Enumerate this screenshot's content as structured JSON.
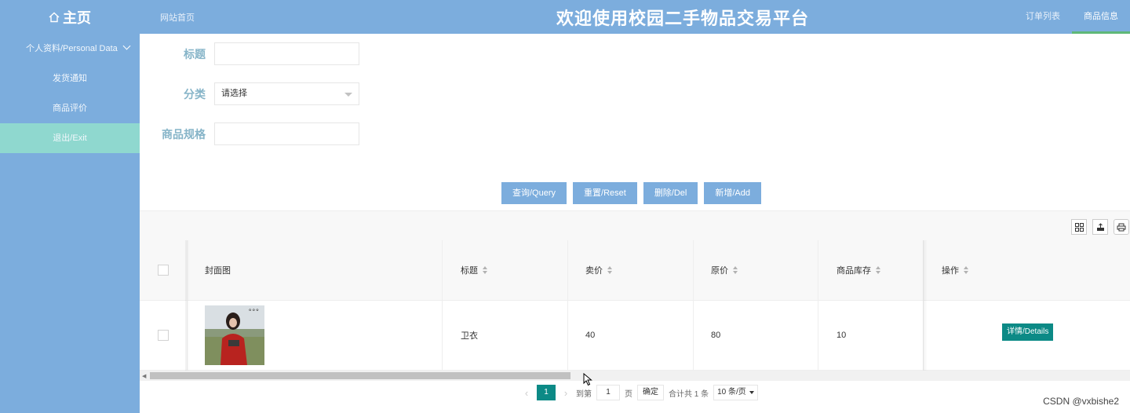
{
  "header": {
    "home_label": "主页",
    "site_home": "网站首页",
    "title": "欢迎使用校园二手物品交易平台",
    "nav": [
      "订单列表",
      "商品信息"
    ],
    "nav_active": "商品信息"
  },
  "sidebar": {
    "items": [
      {
        "label": "个人资料/Personal Data",
        "expandable": true
      },
      {
        "label": "发货通知"
      },
      {
        "label": "商品评价"
      },
      {
        "label": "退出/Exit",
        "active": true
      }
    ]
  },
  "search": {
    "title_label": "标题",
    "title_value": "",
    "category_label": "分类",
    "category_value": "请选择",
    "spec_label": "商品规格",
    "spec_value": ""
  },
  "buttons": {
    "query": "查询/Query",
    "reset": "重置/Reset",
    "delete": "删除/Del",
    "add": "新增/Add"
  },
  "toolbar_icons": [
    "columns-icon",
    "export-icon",
    "print-icon"
  ],
  "table": {
    "columns": [
      "封面图",
      "标题",
      "卖价",
      "原价",
      "商品库存",
      "操作"
    ],
    "rows": [
      {
        "title": "卫衣",
        "price": "40",
        "original_price": "80",
        "stock": "10",
        "action": "详情/Details"
      }
    ]
  },
  "pager": {
    "current": "1",
    "goto_label": "到第",
    "goto_value": "1",
    "page_unit": "页",
    "confirm": "确定",
    "total": "合计共 1 条",
    "page_size": "10 条/页"
  },
  "watermark": "CSDN @vxbishe2",
  "colors": {
    "primary": "#7caddd",
    "sidebar_active": "#8fd8cf",
    "accent": "#0c8a86",
    "label": "#86b4c8"
  }
}
